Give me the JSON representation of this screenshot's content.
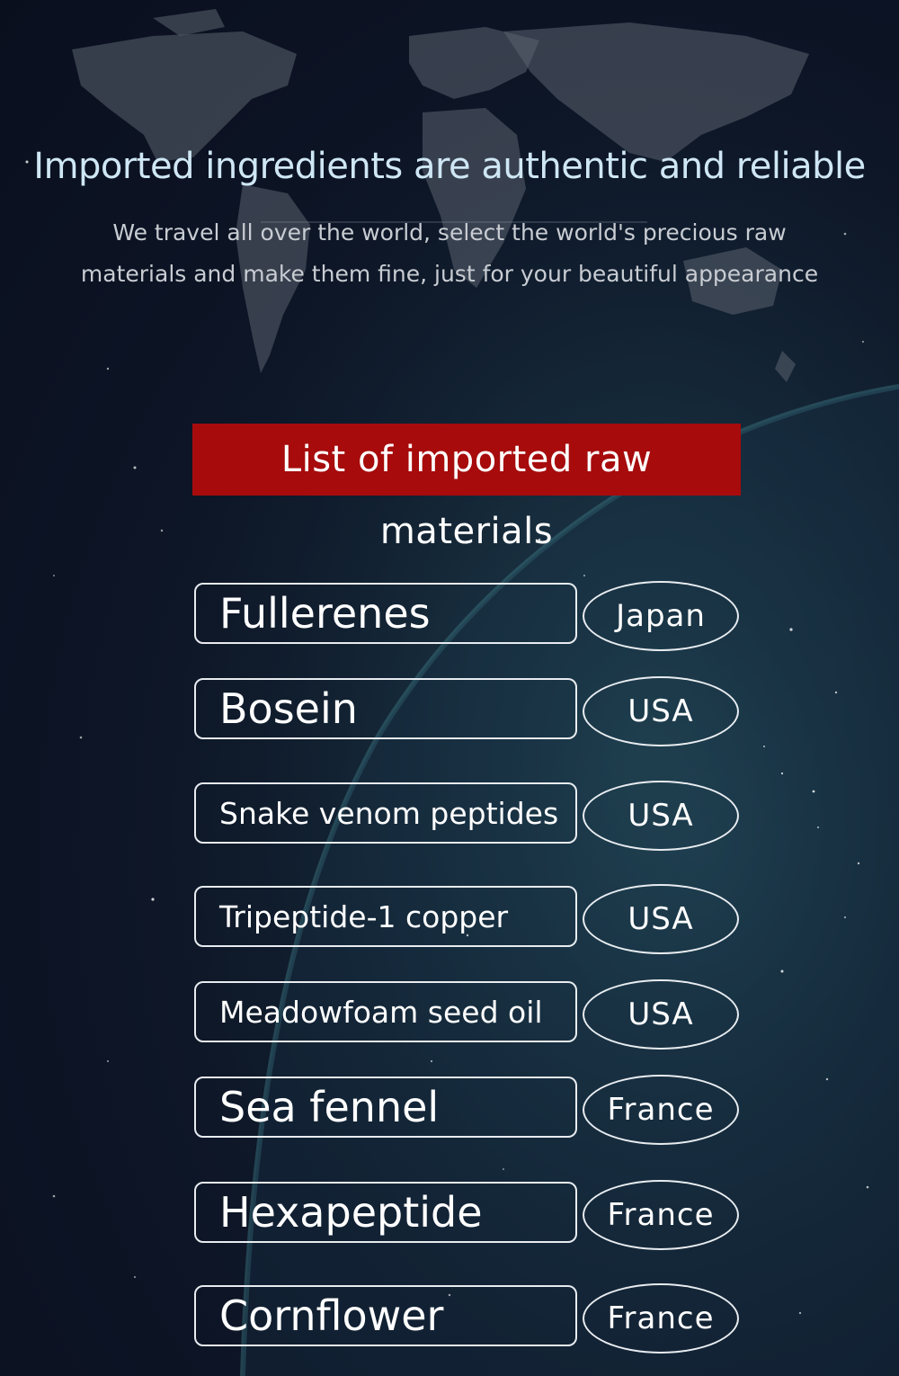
{
  "header": {
    "title": "Imported ingredients are authentic and reliable",
    "subtitle_line1": "We travel all over the world, select the world's precious raw",
    "subtitle_line2": "materials and make them fine, just for your beautiful appearance"
  },
  "banner": {
    "label": "List of imported raw materials"
  },
  "materials": [
    {
      "name": "Fullerenes",
      "country": "Japan"
    },
    {
      "name": "Bosein",
      "country": "USA"
    },
    {
      "name": "Snake venom peptides",
      "country": "USA"
    },
    {
      "name": "Tripeptide-1 copper",
      "country": "USA"
    },
    {
      "name": "Meadowfoam seed oil",
      "country": "USA"
    },
    {
      "name": "Sea fennel",
      "country": "France"
    },
    {
      "name": "Hexapeptide",
      "country": "France"
    },
    {
      "name": "Cornflower",
      "country": "France"
    }
  ],
  "colors": {
    "banner": "#a70b0c",
    "heading": "#cfe7f5",
    "background": "#0d1526"
  }
}
